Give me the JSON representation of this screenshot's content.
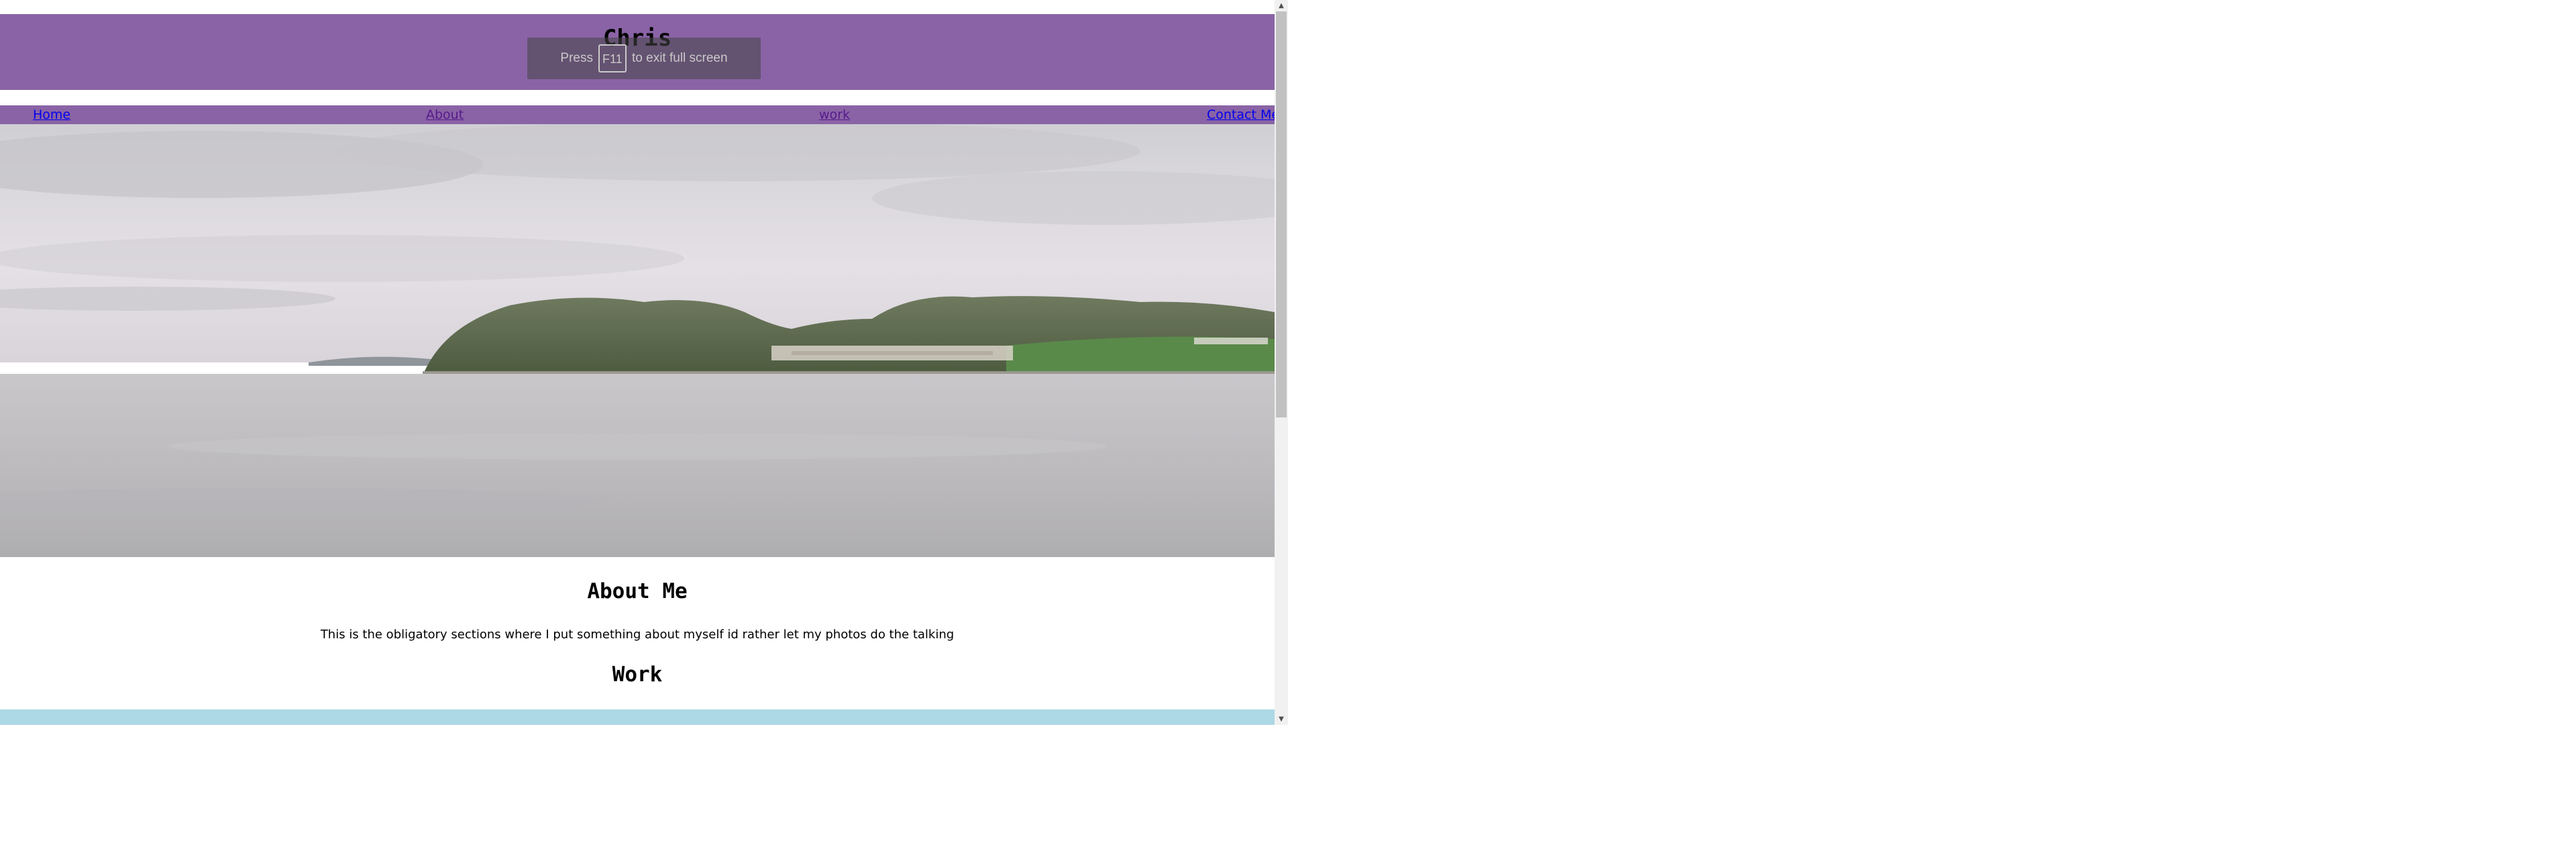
{
  "header": {
    "title": "Chris"
  },
  "fullscreen_notice": {
    "prefix": "Press",
    "key": "F11",
    "suffix": "to exit full screen"
  },
  "nav": {
    "items": [
      {
        "label": "Home"
      },
      {
        "label": "About"
      },
      {
        "label": "work"
      },
      {
        "label": "Contact Me"
      }
    ]
  },
  "about": {
    "heading": "About Me",
    "text": "This is the obligatory sections where I put something about myself id rather let my photos do the talking"
  },
  "work": {
    "heading": "Work"
  },
  "colors": {
    "header_bg": "#8a63a6",
    "nav_bg": "#8a63a6",
    "work_strip": "#add8e6",
    "link_unvisited": "#0000ee",
    "link_visited": "#551a8b"
  }
}
